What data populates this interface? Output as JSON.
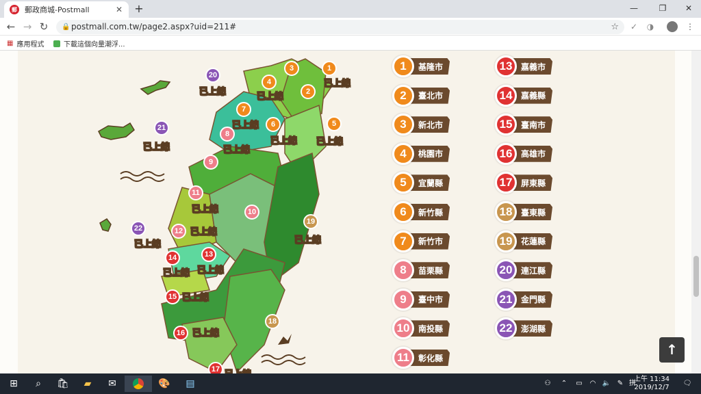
{
  "browser": {
    "tab_title": "郵政商城-Postmall",
    "url": "postmall.com.tw/page2.aspx?uid=211#",
    "bookmarks": [
      {
        "label": "應用程式",
        "icon": "apps-grid-icon"
      },
      {
        "label": "下載這個向量潮浮...",
        "icon": "bookmark-page-icon"
      }
    ]
  },
  "colors": {
    "orange": "#f08a1c",
    "pink": "#ee7e8a",
    "red": "#e03232",
    "tan": "#c8964f",
    "purple": "#8a55b5",
    "ribbon": "#6b4a2e",
    "page_bg": "#f7f3ea"
  },
  "legend": [
    {
      "num": "1",
      "name": "基隆市",
      "color": "orange"
    },
    {
      "num": "2",
      "name": "臺北市",
      "color": "orange"
    },
    {
      "num": "3",
      "name": "新北市",
      "color": "orange"
    },
    {
      "num": "4",
      "name": "桃園市",
      "color": "orange"
    },
    {
      "num": "5",
      "name": "宜蘭縣",
      "color": "orange"
    },
    {
      "num": "6",
      "name": "新竹縣",
      "color": "orange"
    },
    {
      "num": "7",
      "name": "新竹市",
      "color": "orange"
    },
    {
      "num": "8",
      "name": "苗栗縣",
      "color": "pink"
    },
    {
      "num": "9",
      "name": "臺中市",
      "color": "pink"
    },
    {
      "num": "10",
      "name": "南投縣",
      "color": "pink"
    },
    {
      "num": "11",
      "name": "彰化縣",
      "color": "pink"
    },
    {
      "num": "13",
      "name": "嘉義市",
      "color": "red"
    },
    {
      "num": "14",
      "name": "嘉義縣",
      "color": "red"
    },
    {
      "num": "15",
      "name": "臺南市",
      "color": "red"
    },
    {
      "num": "16",
      "name": "高雄市",
      "color": "red"
    },
    {
      "num": "17",
      "name": "屏東縣",
      "color": "red"
    },
    {
      "num": "18",
      "name": "臺東縣",
      "color": "tan"
    },
    {
      "num": "19",
      "name": "花蓮縣",
      "color": "tan"
    },
    {
      "num": "20",
      "name": "連江縣",
      "color": "purple"
    },
    {
      "num": "21",
      "name": "金門縣",
      "color": "purple"
    },
    {
      "num": "22",
      "name": "澎湖縣",
      "color": "purple"
    }
  ],
  "map": {
    "online_label": "已上線",
    "markers": [
      {
        "num": "1",
        "color": "orange",
        "online": true
      },
      {
        "num": "2",
        "color": "orange",
        "online": false
      },
      {
        "num": "3",
        "color": "orange",
        "online": false
      },
      {
        "num": "4",
        "color": "orange",
        "online": true
      },
      {
        "num": "5",
        "color": "orange",
        "online": true
      },
      {
        "num": "6",
        "color": "orange",
        "online": true
      },
      {
        "num": "7",
        "color": "orange",
        "online": true
      },
      {
        "num": "8",
        "color": "pink",
        "online": true
      },
      {
        "num": "9",
        "color": "pink",
        "online": true
      },
      {
        "num": "10",
        "color": "pink",
        "online": false
      },
      {
        "num": "11",
        "color": "pink",
        "online": true
      },
      {
        "num": "12",
        "color": "pink",
        "online": true
      },
      {
        "num": "13",
        "color": "red",
        "online": true
      },
      {
        "num": "14",
        "color": "red",
        "online": true
      },
      {
        "num": "15",
        "color": "red",
        "online": true
      },
      {
        "num": "16",
        "color": "red",
        "online": true
      },
      {
        "num": "17",
        "color": "red",
        "online": true
      },
      {
        "num": "18",
        "color": "tan",
        "online": false
      },
      {
        "num": "19",
        "color": "tan",
        "online": true
      },
      {
        "num": "20",
        "color": "purple",
        "online": true
      },
      {
        "num": "21",
        "color": "purple",
        "online": true
      },
      {
        "num": "22",
        "color": "purple",
        "online": true
      }
    ]
  },
  "back_to_top": "↑",
  "taskbar": {
    "time": "上午 11:34",
    "date": "2019/12/7",
    "icons": [
      "windows-start-icon",
      "search-icon",
      "store-icon",
      "file-explorer-icon",
      "mail-icon",
      "chrome-icon",
      "paint-icon",
      "notepad-icon"
    ]
  }
}
